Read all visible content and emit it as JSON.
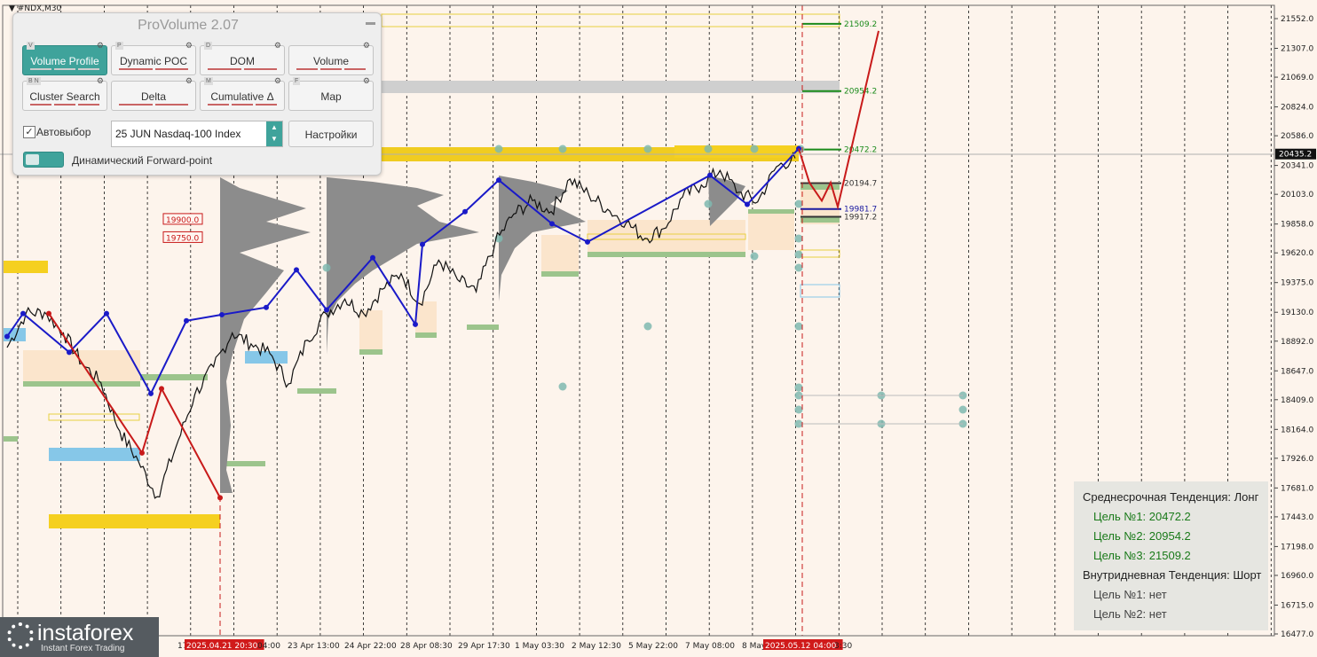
{
  "symbol": "#NDX,M30",
  "panel": {
    "title": "ProVolume 2.07",
    "buttons": [
      {
        "label": "Volume Profile",
        "letter": "V",
        "active": true
      },
      {
        "label": "Dynamic POC",
        "letter": "P",
        "active": false
      },
      {
        "label": "DOM",
        "letter": "D",
        "active": false
      },
      {
        "label": "Volume",
        "letter": "",
        "active": false
      },
      {
        "label": "Cluster Search",
        "letter": "B N",
        "active": false
      },
      {
        "label": "Delta",
        "letter": "",
        "active": false
      },
      {
        "label": "Cumulative Δ",
        "letter": "M",
        "active": false
      },
      {
        "label": "Map",
        "letter": "F",
        "active": false
      }
    ],
    "auto_label": "Автовыбор",
    "auto_checked": true,
    "instrument": "25 JUN Nasdaq-100 Index",
    "settings_label": "Настройки",
    "forward_point_label": "Динамический Forward-point"
  },
  "trend": {
    "mid_title": "Среднесрочная Тенденция: Лонг",
    "mid_targets": [
      "Цель №1: 20472.2",
      "Цель №2: 20954.2",
      "Цель №3: 21509.2"
    ],
    "intra_title": "Внутридневная Тенденция: Шорт",
    "intra_targets": [
      "Цель №1: нет",
      "Цель №2: нет"
    ],
    "colors": {
      "long": "#1a7a1a",
      "none": "#444444"
    }
  },
  "logo": {
    "name": "instaforex",
    "tagline": "Instant Forex Trading"
  },
  "chart_data": {
    "type": "line",
    "y_ticks": [
      "21552.0",
      "21307.0",
      "21069.0",
      "20824.0",
      "20586.0",
      "20341.0",
      "20103.0",
      "19858.0",
      "19620.0",
      "19375.0",
      "19130.0",
      "18892.0",
      "18647.0",
      "18409.0",
      "18164.0",
      "17926.0",
      "17681.0",
      "17443.0",
      "17198.0",
      "16960.0",
      "16715.0",
      "16477.0"
    ],
    "ylim": [
      16477.0,
      21552.0
    ],
    "current_price": "20435.2",
    "x_labels": [
      "17",
      "2025.04.21 20:30",
      "04:00",
      "23 Apr 13:00",
      "24 Apr 22:00",
      "28 Apr 08:30",
      "29 Apr 17:30",
      "1 May 03:30",
      "2 May 12:30",
      "5 May 22:00",
      "7 May 08:00",
      "8 May",
      "2025.05.12 04:00",
      "3:30"
    ],
    "target_levels": [
      {
        "label": "21509.2",
        "color": "#1a8a1a"
      },
      {
        "label": "20954.2",
        "color": "#1a8a1a"
      },
      {
        "label": "20472.2",
        "color": "#1a8a1a"
      },
      {
        "label": "20194.7",
        "color": "#333333"
      },
      {
        "label": "19981.7",
        "color": "#1a1aa0"
      },
      {
        "label": "19917.2",
        "color": "#333333"
      }
    ],
    "price_tags": [
      "19900.0",
      "19750.0"
    ],
    "series": [
      {
        "values": [
          18840,
          19120,
          19130,
          18960,
          18710,
          18550,
          18150,
          17900,
          17610,
          18020,
          18450,
          18680,
          18960,
          18870,
          18790,
          18540,
          18900,
          19120,
          19240,
          19120,
          19320,
          19450,
          19200,
          19560,
          19400,
          19300,
          19700,
          19940,
          20050,
          19960,
          20230,
          20100,
          19980,
          19870,
          19740,
          19820,
          20080,
          20180,
          20300,
          20120,
          20040,
          20330,
          20400
        ]
      }
    ],
    "zigzag": [
      {
        "color": "#1a1ac8",
        "values": [
          18930,
          19120,
          18800,
          19120,
          18460,
          19060,
          19110,
          19170,
          19480,
          19150,
          19580,
          19030,
          19690,
          19960,
          20220,
          19860,
          19710,
          20260,
          20020,
          20480
        ]
      },
      {
        "color": "#c81a1a",
        "values": [
          19120,
          17970,
          18500,
          17600
        ]
      }
    ],
    "forecast": {
      "color": "#c81a1a",
      "values": [
        20480,
        20200,
        20050,
        20200,
        20000,
        20250,
        21450
      ]
    }
  }
}
